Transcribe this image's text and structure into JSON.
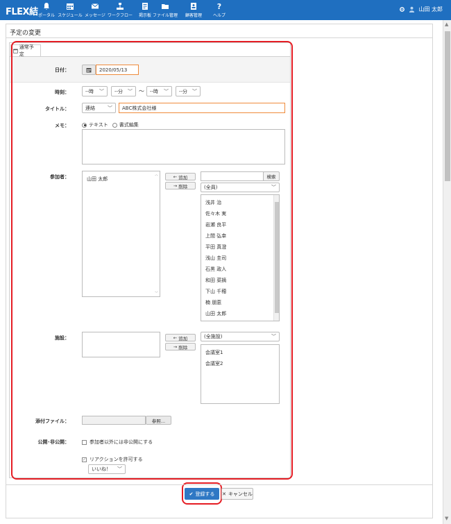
{
  "app": {
    "logo": "FLEX結",
    "user_name": "山田 太郎"
  },
  "nav": [
    {
      "label": "ポータル",
      "icon": "bell-icon"
    },
    {
      "label": "スケジュール",
      "icon": "calendar-icon"
    },
    {
      "label": "メッセージ",
      "icon": "mail-icon"
    },
    {
      "label": "ワークフロー",
      "icon": "workflow-icon"
    },
    {
      "label": "掲示板",
      "icon": "board-icon"
    },
    {
      "label": "ファイル管理",
      "icon": "folder-icon"
    },
    {
      "label": "顧客管理",
      "icon": "customer-icon"
    },
    {
      "label": "ヘルプ",
      "icon": "help-icon"
    }
  ],
  "page": {
    "title": "予定の変更",
    "tab": "通常予定"
  },
  "form": {
    "date": {
      "label": "日付：",
      "value": "2020/05/13"
    },
    "time": {
      "label": "時刻：",
      "start_hour": "--時",
      "start_min": "--分",
      "tilde": "〜",
      "end_hour": "--時",
      "end_min": "--分"
    },
    "title": {
      "label": "タイトル：",
      "category": "連絡",
      "value": "ABC株式会社様"
    },
    "memo": {
      "label": "メモ：",
      "option_text": "テキスト",
      "option_rich": "書式編集",
      "value": ""
    },
    "participants": {
      "label": "参加者：",
      "selected": [
        "山田 太郎"
      ],
      "add": "追加",
      "remove": "削除",
      "search_value": "",
      "search_button": "検索",
      "group_select": "(全員)",
      "candidates": [
        "浅井 治",
        "佐々木 実",
        "岩瀬 良平",
        "上間 弘幸",
        "平田 真澄",
        "浅山 圭司",
        "石黒 政人",
        "和田 菜摘",
        "下山 千穂",
        "楠 朋恵",
        "山田 太郎"
      ]
    },
    "facilities": {
      "label": "施設：",
      "add": "追加",
      "remove": "削除",
      "group_select": "(全施設)",
      "candidates": [
        "会議室1",
        "会議室2"
      ]
    },
    "attachment": {
      "label": "添付ファイル：",
      "button": "参照..."
    },
    "visibility": {
      "label": "公開･非公開：",
      "private_label": "参加者以外には非公開にする",
      "private_checked": false,
      "reaction_label": "リアクションを許可する",
      "reaction_checked": true,
      "reaction_select": "いいね！"
    }
  },
  "actions": {
    "submit": "登録する",
    "cancel": "キャンセル"
  },
  "colors": {
    "header": "#1f6fc0",
    "highlight": "#e51c23",
    "primary_button": "#2f78c4",
    "focus_border": "#ef8a3a"
  }
}
